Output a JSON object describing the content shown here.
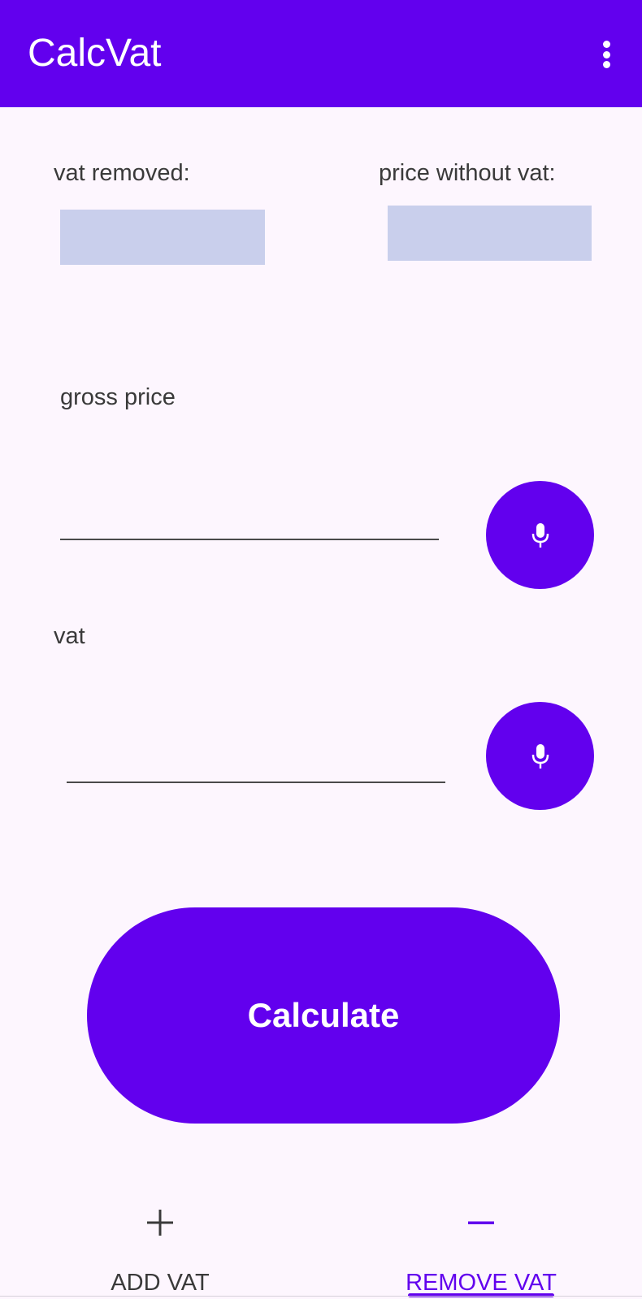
{
  "app_bar": {
    "title": "CalcVat",
    "menu_icon": "more-vert-icon"
  },
  "results": {
    "vat_removed_label": "vat removed:",
    "vat_removed_value": "",
    "price_without_vat_label": "price without vat:",
    "price_without_vat_value": ""
  },
  "gross_price": {
    "label": "gross price",
    "value": "",
    "mic_icon": "microphone-icon"
  },
  "vat": {
    "label": "vat",
    "value": "",
    "mic_icon": "microphone-icon"
  },
  "calculate_button": {
    "label": "Calculate"
  },
  "tabs": [
    {
      "label": "ADD VAT",
      "icon": "plus-icon",
      "selected": false
    },
    {
      "label": "REMOVE VAT",
      "icon": "minus-icon",
      "selected": true
    }
  ],
  "colors": {
    "primary": "#6200EE",
    "background": "#FDF6FE",
    "result_box": "#C9CFEC",
    "text": "#3A3A3A",
    "selected_tab_text": "#6200EE"
  }
}
